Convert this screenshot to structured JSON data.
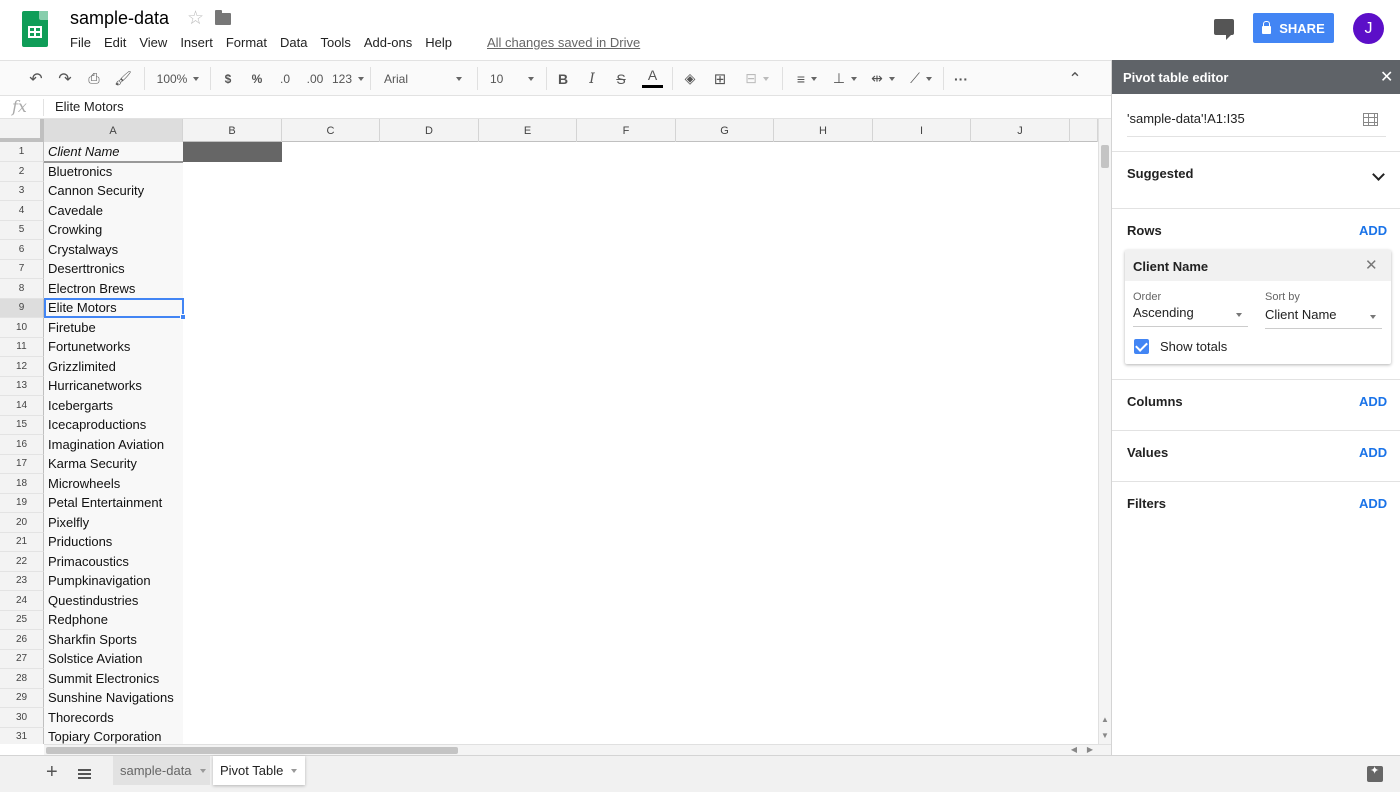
{
  "header": {
    "doc_title": "sample-data",
    "menus": [
      "File",
      "Edit",
      "View",
      "Insert",
      "Format",
      "Data",
      "Tools",
      "Add-ons",
      "Help"
    ],
    "save_status": "All changes saved in Drive",
    "share_label": "SHARE",
    "avatar_initial": "J"
  },
  "toolbar": {
    "zoom": "100%",
    "currency": "$",
    "percent": "%",
    "decrease_decimals": ".0",
    "increase_decimals": ".00",
    "more_formats": "123",
    "font": "Arial",
    "font_size": "10",
    "bold": "B",
    "italic": "I",
    "strikethrough": "S",
    "text_color": "A",
    "more": "···",
    "collapse": "⌃"
  },
  "formula_bar": {
    "fx": "fx",
    "value": "Elite Motors"
  },
  "grid": {
    "columns": [
      "A",
      "B",
      "C",
      "D",
      "E",
      "F",
      "G",
      "H",
      "I",
      "J"
    ],
    "active_column": "A",
    "active_row": "9",
    "rows": [
      {
        "n": "1",
        "a": "Client Name"
      },
      {
        "n": "2",
        "a": "Bluetronics"
      },
      {
        "n": "3",
        "a": "Cannon Security"
      },
      {
        "n": "4",
        "a": "Cavedale"
      },
      {
        "n": "5",
        "a": "Crowking"
      },
      {
        "n": "6",
        "a": "Crystalways"
      },
      {
        "n": "7",
        "a": "Deserttronics"
      },
      {
        "n": "8",
        "a": "Electron Brews"
      },
      {
        "n": "9",
        "a": "Elite Motors"
      },
      {
        "n": "10",
        "a": "Firetube"
      },
      {
        "n": "11",
        "a": "Fortunetworks"
      },
      {
        "n": "12",
        "a": "Grizzlimited"
      },
      {
        "n": "13",
        "a": "Hurricanetworks"
      },
      {
        "n": "14",
        "a": "Icebergarts"
      },
      {
        "n": "15",
        "a": "Icecaproductions"
      },
      {
        "n": "16",
        "a": "Imagination Aviation"
      },
      {
        "n": "17",
        "a": "Karma Security"
      },
      {
        "n": "18",
        "a": "Microwheels"
      },
      {
        "n": "19",
        "a": "Petal Entertainment"
      },
      {
        "n": "20",
        "a": "Pixelfly"
      },
      {
        "n": "21",
        "a": "Priductions"
      },
      {
        "n": "22",
        "a": "Primacoustics"
      },
      {
        "n": "23",
        "a": "Pumpkinavigation"
      },
      {
        "n": "24",
        "a": "Questindustries"
      },
      {
        "n": "25",
        "a": "Redphone"
      },
      {
        "n": "26",
        "a": "Sharkfin Sports"
      },
      {
        "n": "27",
        "a": "Solstice Aviation"
      },
      {
        "n": "28",
        "a": "Summit Electronics"
      },
      {
        "n": "29",
        "a": "Sunshine Navigations"
      },
      {
        "n": "30",
        "a": "Thorecords"
      },
      {
        "n": "31",
        "a": "Topiary Corporation"
      }
    ]
  },
  "sheets": {
    "tabs": [
      "sample-data",
      "Pivot Table"
    ],
    "active": "Pivot Table"
  },
  "pivot_editor": {
    "title": "Pivot table editor",
    "range": "'sample-data'!A1:I35",
    "suggested_label": "Suggested",
    "rows_label": "Rows",
    "columns_label": "Columns",
    "values_label": "Values",
    "filters_label": "Filters",
    "add_label": "ADD",
    "row_field": {
      "name": "Client Name",
      "order_label": "Order",
      "order_value": "Ascending",
      "sort_by_label": "Sort by",
      "sort_by_value": "Client Name",
      "show_totals_label": "Show totals",
      "show_totals_checked": true
    }
  },
  "colors": {
    "accent": "#4285f4",
    "share_button": "#4285f4",
    "avatar": "#5c0fc8",
    "sheets_green": "#0f9d58",
    "panel_header": "#5f6368",
    "add_link": "#1a73e8"
  }
}
